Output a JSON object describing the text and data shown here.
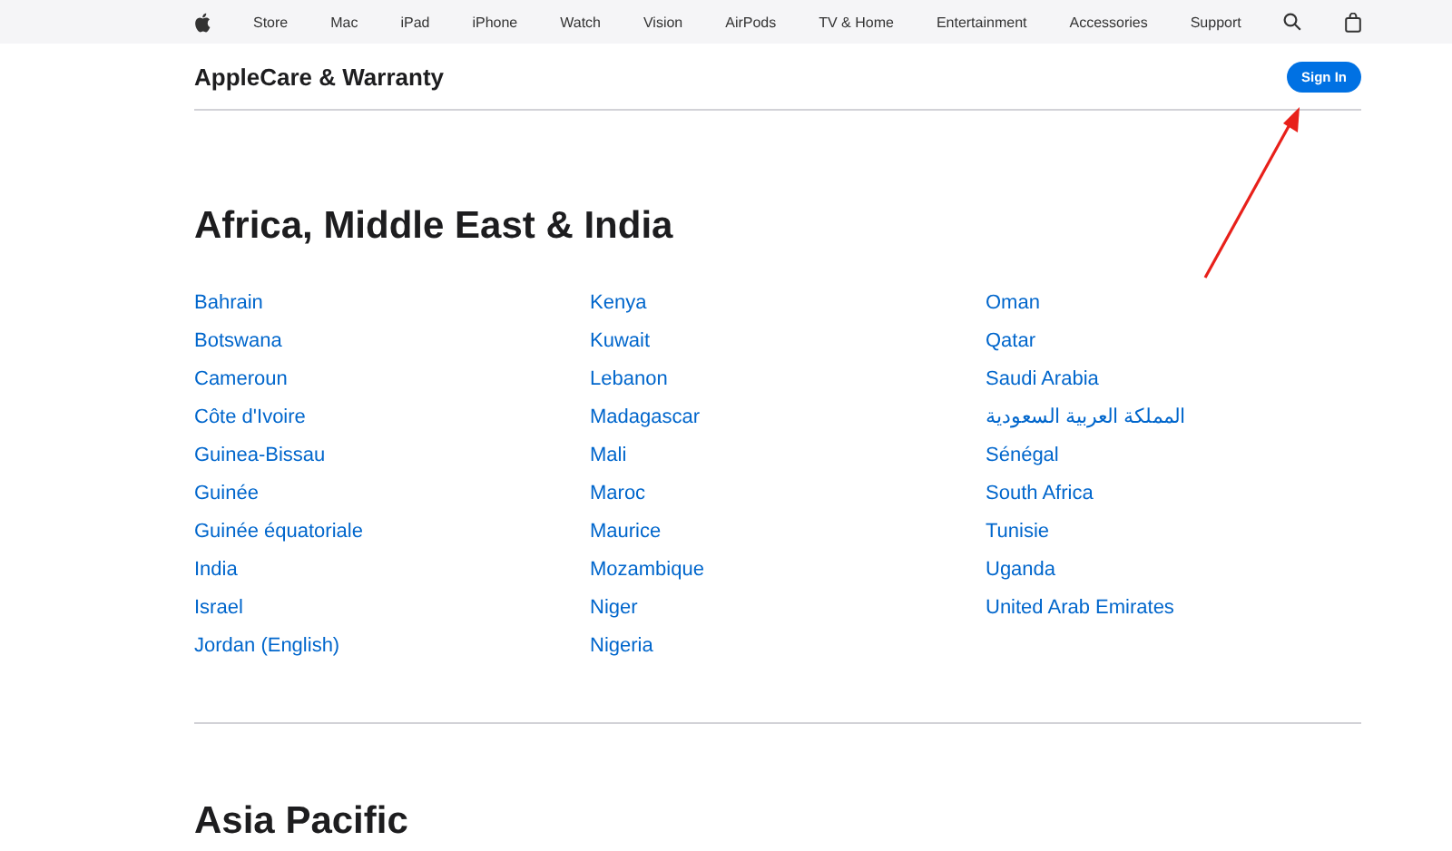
{
  "nav": {
    "items": [
      "Store",
      "Mac",
      "iPad",
      "iPhone",
      "Watch",
      "Vision",
      "AirPods",
      "TV & Home",
      "Entertainment",
      "Accessories",
      "Support"
    ]
  },
  "header": {
    "title": "AppleCare & Warranty",
    "button": "Sign In"
  },
  "sections": [
    {
      "title": "Africa, Middle East & India",
      "columns": [
        [
          "Bahrain",
          "Botswana",
          "Cameroun",
          "Côte d'Ivoire",
          "Guinea-Bissau",
          "Guinée",
          "Guinée équatoriale",
          "India",
          "Israel",
          "Jordan (English)"
        ],
        [
          "Kenya",
          "Kuwait",
          "Lebanon",
          "Madagascar",
          "Mali",
          "Maroc",
          "Maurice",
          "Mozambique",
          "Niger",
          "Nigeria"
        ],
        [
          "Oman",
          "Qatar",
          "Saudi Arabia",
          "المملكة العربية السعودية",
          "Sénégal",
          "South Africa",
          "Tunisie",
          "Uganda",
          "United Arab Emirates"
        ]
      ]
    },
    {
      "title": "Asia Pacific"
    }
  ]
}
